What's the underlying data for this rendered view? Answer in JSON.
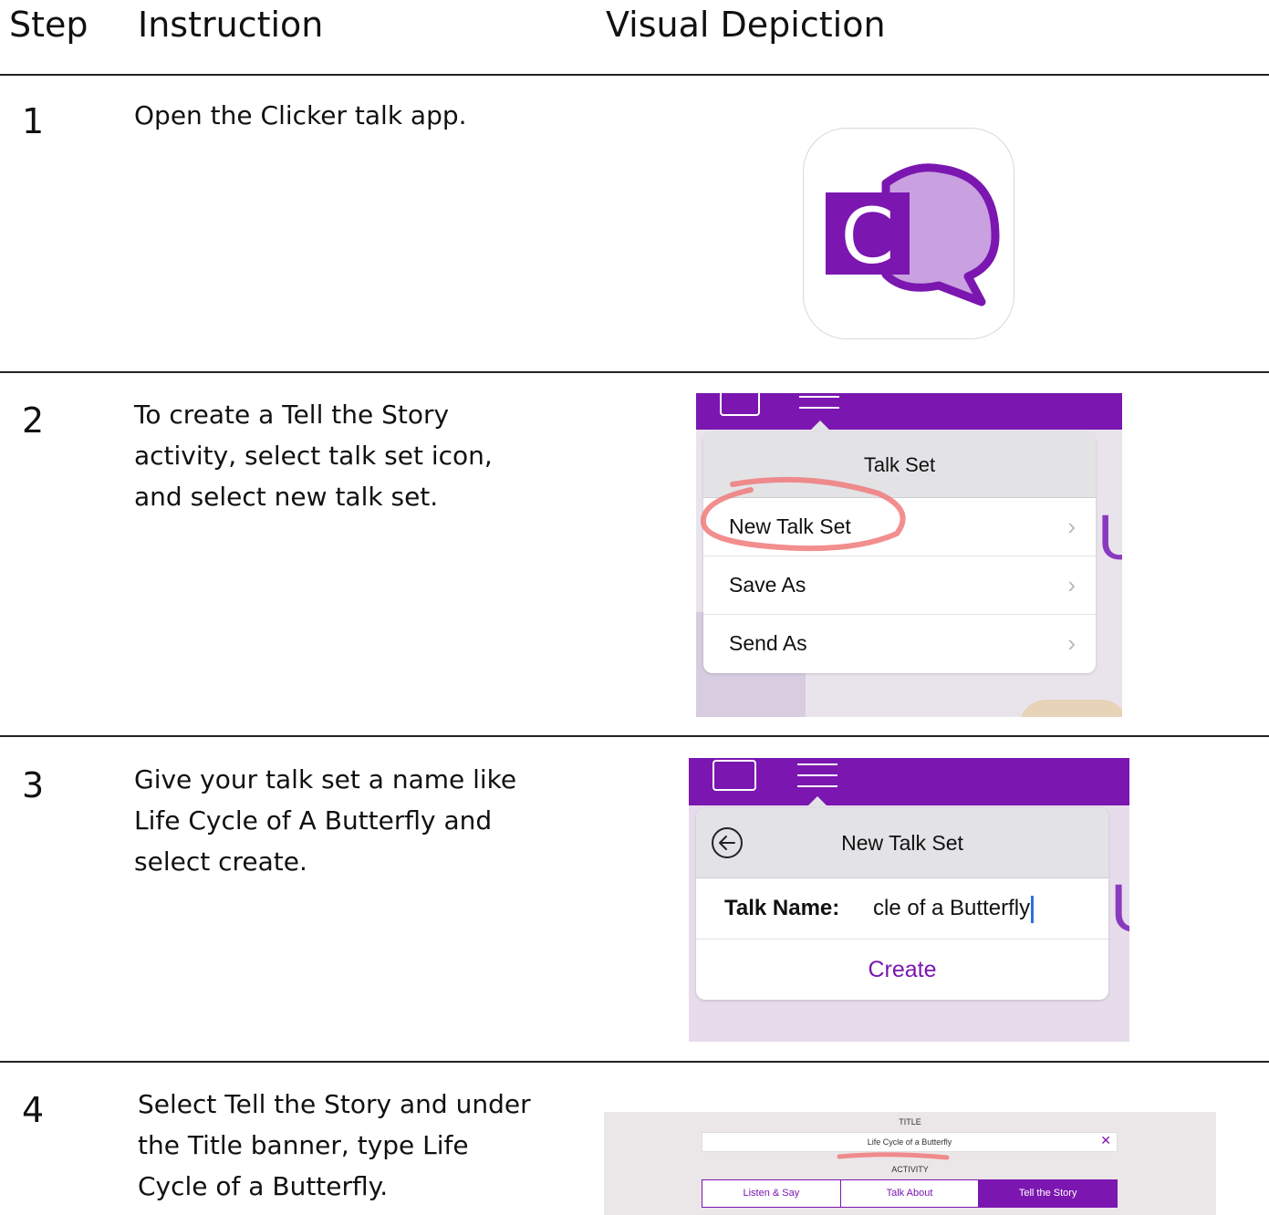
{
  "headers": {
    "step": "Step",
    "instruction": "Instruction",
    "visual": "Visual Depiction"
  },
  "steps": [
    {
      "number": "1",
      "lines": [
        "Open the Clicker talk app."
      ]
    },
    {
      "number": "2",
      "lines": [
        "To create a Tell the Story",
        "activity, select talk set icon,",
        "and select new talk set."
      ]
    },
    {
      "number": "3",
      "lines": [
        "Give your talk set a name like",
        "Life Cycle of A Butterfly and",
        "select create."
      ]
    },
    {
      "number": "4",
      "lines": [
        "Select Tell the Story and under",
        "the Title banner, type Life",
        "Cycle of a Butterfly."
      ]
    }
  ],
  "app_icon": {
    "letter": "C",
    "icon": "clicker-talk-app-icon",
    "colors": {
      "primary": "#7b16b0",
      "light": "#c9a0e0"
    }
  },
  "shot2": {
    "title": "Talk Set",
    "items": [
      {
        "label": "New Talk Set",
        "highlighted": true
      },
      {
        "label": "Save As",
        "highlighted": false
      },
      {
        "label": "Send As",
        "highlighted": false
      }
    ],
    "chevron": "›",
    "highlight_color": "#f07a7a"
  },
  "shot3": {
    "title": "New Talk Set",
    "name_label": "Talk Name:",
    "name_value": "cle of a Butterfly",
    "create_label": "Create",
    "back_icon": "back-arrow-icon"
  },
  "shot4": {
    "title_label": "TITLE",
    "title_value": "Life Cycle of a Butterfly",
    "clear_symbol": "✕",
    "activity_label": "ACTIVITY",
    "tabs": [
      {
        "label": "Listen & Say",
        "active": false
      },
      {
        "label": "Talk About",
        "active": false
      },
      {
        "label": "Tell the Story",
        "active": true
      }
    ]
  },
  "colors": {
    "purple": "#7b16b0",
    "rule": "#222222"
  }
}
